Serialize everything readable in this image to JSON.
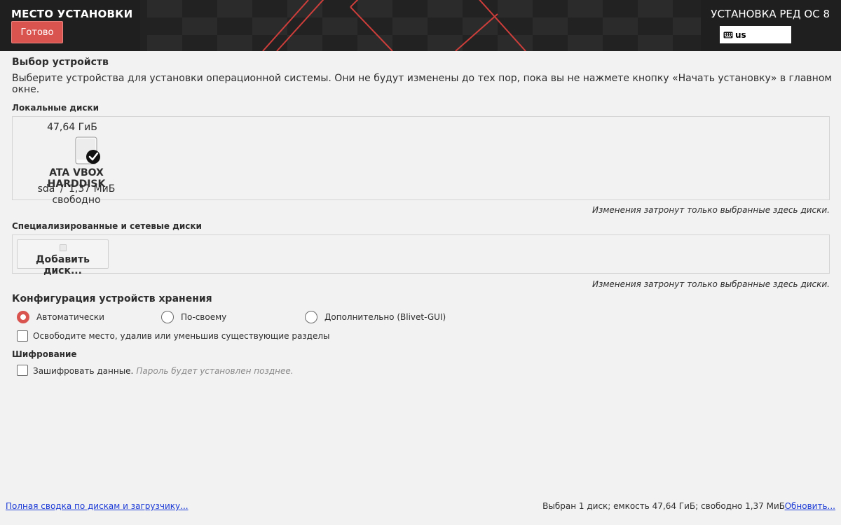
{
  "header": {
    "spoke_title": "МЕСТО УСТАНОВКИ",
    "done_label": "Готово",
    "product_title": "УСТАНОВКА РЕД ОС 8",
    "keyboard_layout": "us",
    "accent_color": "#d9534f"
  },
  "device_selection": {
    "heading": "Выбор устройств",
    "description": "Выберите устройства для установки операционной системы. Они не будут изменены до тех пор, пока вы не нажмете кнопку «Начать установку» в главном окне."
  },
  "local_disks": {
    "heading": "Локальные диски",
    "disks": [
      {
        "size": "47,64 ГиБ",
        "name": "ATA VBOX HARDDISK",
        "device": "sda",
        "separator": "/",
        "free": "1,37 МиБ свободно",
        "icon": "harddisk-checked-icon"
      }
    ],
    "note": "Изменения затронут только выбранные здесь диски."
  },
  "network_disks": {
    "heading": "Специализированные и сетевые диски",
    "add_button_label": "Добавить диск...",
    "note": "Изменения затронут только выбранные здесь диски."
  },
  "storage_config": {
    "heading": "Конфигурация устройств хранения",
    "options": [
      {
        "label": "Автоматически",
        "selected": true
      },
      {
        "label": "По-своему",
        "selected": false
      },
      {
        "label": "Дополнительно (Blivet-GUI)",
        "selected": false
      }
    ],
    "reclaim_label": "Освободите место, удалив или уменьшив существующие разделы"
  },
  "encryption": {
    "heading": "Шифрование",
    "encrypt_label": "Зашифровать данные.",
    "encrypt_hint": "Пароль будет установлен позднее."
  },
  "footer": {
    "summary_link": "Полная сводка по дискам и загрузчику...",
    "status": "Выбран 1 диск; емкость 47,64 ГиБ; свободно 1,37 МиБ",
    "refresh_link": "Обновить..."
  }
}
